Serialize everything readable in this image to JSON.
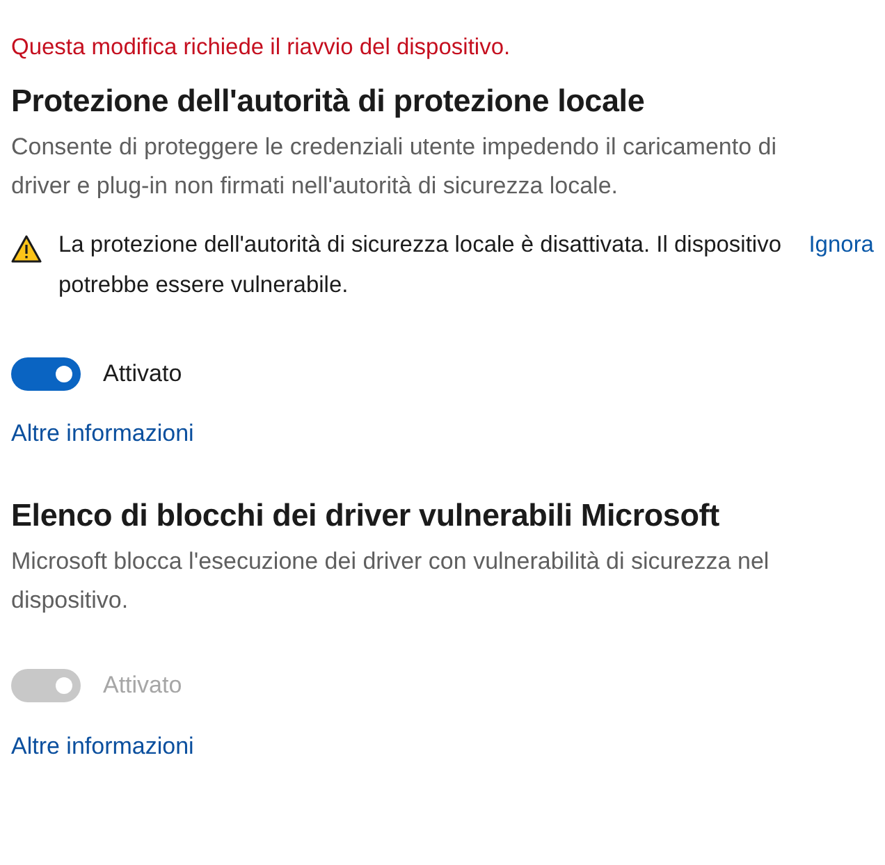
{
  "notice": "Questa modifica richiede il riavvio del dispositivo.",
  "sections": [
    {
      "title": "Protezione dell'autorità di protezione locale",
      "description": "Consente di proteggere le credenziali utente impedendo il caricamento di driver e plug-in non firmati nell'autorità di sicurezza locale.",
      "warning": {
        "text": "La protezione dell'autorità di sicurezza locale è disattivata. Il dispositivo potrebbe essere vulnerabile.",
        "action": "Ignora"
      },
      "toggle": {
        "on": true,
        "disabled": false,
        "label": "Attivato"
      },
      "link": "Altre informazioni"
    },
    {
      "title": "Elenco di blocchi dei driver vulnerabili Microsoft",
      "description": "Microsoft blocca l'esecuzione dei driver con vulnerabilità di sicurezza nel dispositivo.",
      "toggle": {
        "on": true,
        "disabled": true,
        "label": "Attivato"
      },
      "link": "Altre informazioni"
    }
  ]
}
